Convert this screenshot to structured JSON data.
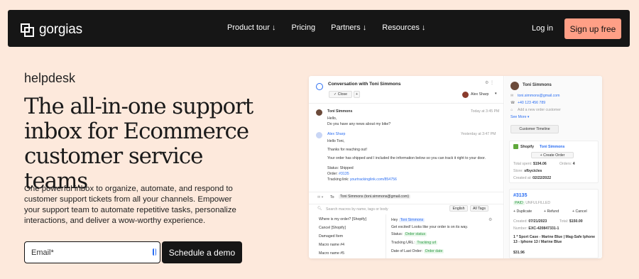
{
  "nav": {
    "logo_text": "gorgias",
    "links": [
      "Product tour ↓",
      "Pricing",
      "Partners ↓",
      "Resources ↓"
    ],
    "login": "Log in",
    "signup": "Sign up free"
  },
  "hero": {
    "eyebrow": "helpdesk",
    "headline": "The all-in-one support inbox for Ecommerce customer service teams",
    "subtitle": "One powerful inbox to organize, automate, and respond to customer support tickets from all your channels. Empower your support team to automate repetitive tasks, personalize interactions, and deliver a wow-worthy experience.",
    "email_placeholder": "Email*",
    "cta": "Schedule a demo"
  },
  "app": {
    "conversation_title": "Conversation with Toni Simmons",
    "close_label": "✓ Close",
    "assignee": "Alex Sharp",
    "msg1_author": "Toni Simmons",
    "msg1_time": "Today at 3:45 PM",
    "msg1_line1": "Hello,",
    "msg1_line2": "Do you have any news about my bike?",
    "msg2_author": "Alex Sharp",
    "msg2_time": "Yesterday at 3:47 PM",
    "msg2_line1": "Hello Toni,",
    "msg2_line2": "Thanks for reaching out!",
    "msg2_line3": "Your order has shipped and I included the information below so you can track it right to your door.",
    "msg2_status": "Status: Shipped",
    "msg2_order": "Order: ",
    "msg2_order_link": "#3135",
    "msg2_tracking": "Tracking link: ",
    "msg2_tracking_link": "yourtrackinglink.com/854756",
    "reply_to_label": "To",
    "reply_to_value": "Toni Simmons (toni.simmons@gmail.com)",
    "search_placeholder": "Search macros by name, tags or body",
    "language": "English",
    "tags_filter": "All Tags",
    "macros": [
      "Where is my order? [Shopify]",
      "Cancel [Shopify]",
      "Damaged Item",
      "Macro name #4",
      "Macro name #5"
    ],
    "preview_hey": "Hey",
    "preview_name": "Toni Simmons",
    "preview_line": "Get excited! Looks like your order is on its way.",
    "preview_status_label": "Status:",
    "preview_status_tag": "Order status",
    "preview_tracking_label": "Tracking URL:",
    "preview_tracking_tag": "Tracking url",
    "preview_date_label": "Date of Last Order:",
    "preview_date_tag": "Order date"
  },
  "customer": {
    "name": "Toni Simmons",
    "email": "toni.simmons@gmail.com",
    "phone": "+40 123 456 789",
    "address_placeholder": "Add a new order customer",
    "see_more": "See More ▾",
    "timeline_btn": "Customer Timeline",
    "shopify_label": "Shopify",
    "shopify_name": "Toni Simmons",
    "create_order": "+ Create Order",
    "total_spent_label": "Total spent:",
    "total_spent": "$194.06",
    "orders_label": "Orders:",
    "orders": "4",
    "store_label": "Store:",
    "store": "sfbycicles",
    "created_label": "Created at:",
    "created": "02/22/2022",
    "order_no": "#3135",
    "order_badge1": "PAID",
    "order_badge2": "UNFULFILLED",
    "dup": "+ Duplicate",
    "refund": "+ Refund",
    "cancel": "+ Cancel",
    "order_created_label": "Created:",
    "order_created": "07/21/2023",
    "order_total_label": "Total:",
    "order_total": "$150.00",
    "order_number_label": "Number:",
    "order_number": "EXC-420847331-1",
    "item_title": "1 * Sport Case - Marine Blue | Mag-Safe Iphone 13 - Iphone 13 / Marine Blue",
    "item_price": "$31.96"
  },
  "colors": {
    "background": "#fde9dc",
    "nav": "#161616",
    "accent": "#ff9f86",
    "link": "#2b6ef2"
  }
}
